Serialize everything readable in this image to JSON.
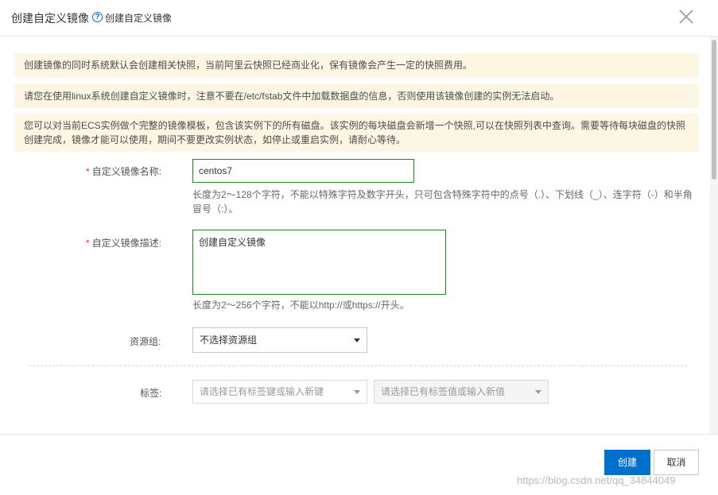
{
  "header": {
    "title": "创建自定义镜像",
    "help_icon": "?",
    "subtitle": "创建自定义镜像"
  },
  "notices": [
    "创建镜像的同时系统默认会创建相关快照，当前阿里云快照已经商业化，保有镜像会产生一定的快照费用。",
    "请您在使用linux系统创建自定义镜像时，注意不要在/etc/fstab文件中加载数据盘的信息，否则使用该镜像创建的实例无法启动。",
    "您可以对当前ECS实例做个完整的镜像模板，包含该实例下的所有磁盘。该实例的每块磁盘会新增一个快照,可以在快照列表中查询。需要等待每块磁盘的快照创建完成，镜像才能可以使用，期间不要更改实例状态，如停止或重启实例，请耐心等待。"
  ],
  "form": {
    "required_mark": "*",
    "name_label": "自定义镜像名称:",
    "name_value": "centos7",
    "name_hint": "长度为2～128个字符，不能以特殊字符及数字开头，只可包含特殊字符中的点号（.）、下划线（_）、连字符（-）和半角冒号（:）。",
    "desc_label": "自定义镜像描述:",
    "desc_value": "创建自定义镜像",
    "desc_hint": "长度为2～256个字符，不能以http://或https://开头。",
    "resource_group_label": "资源组:",
    "resource_group_value": "不选择资源组",
    "tag_label": "标签:",
    "tag_key_placeholder": "请选择已有标签键或输入新键",
    "tag_value_placeholder": "请选择已有标签值或输入新值"
  },
  "footer": {
    "create_label": "创建",
    "cancel_label": "取消"
  },
  "watermark": "https://blog.csdn.net/qq_34844049",
  "colors": {
    "primary": "#0070cc",
    "notice_bg": "#fdf6e3",
    "input_border_valid": "#1b8a1b",
    "required": "#e4393c"
  }
}
